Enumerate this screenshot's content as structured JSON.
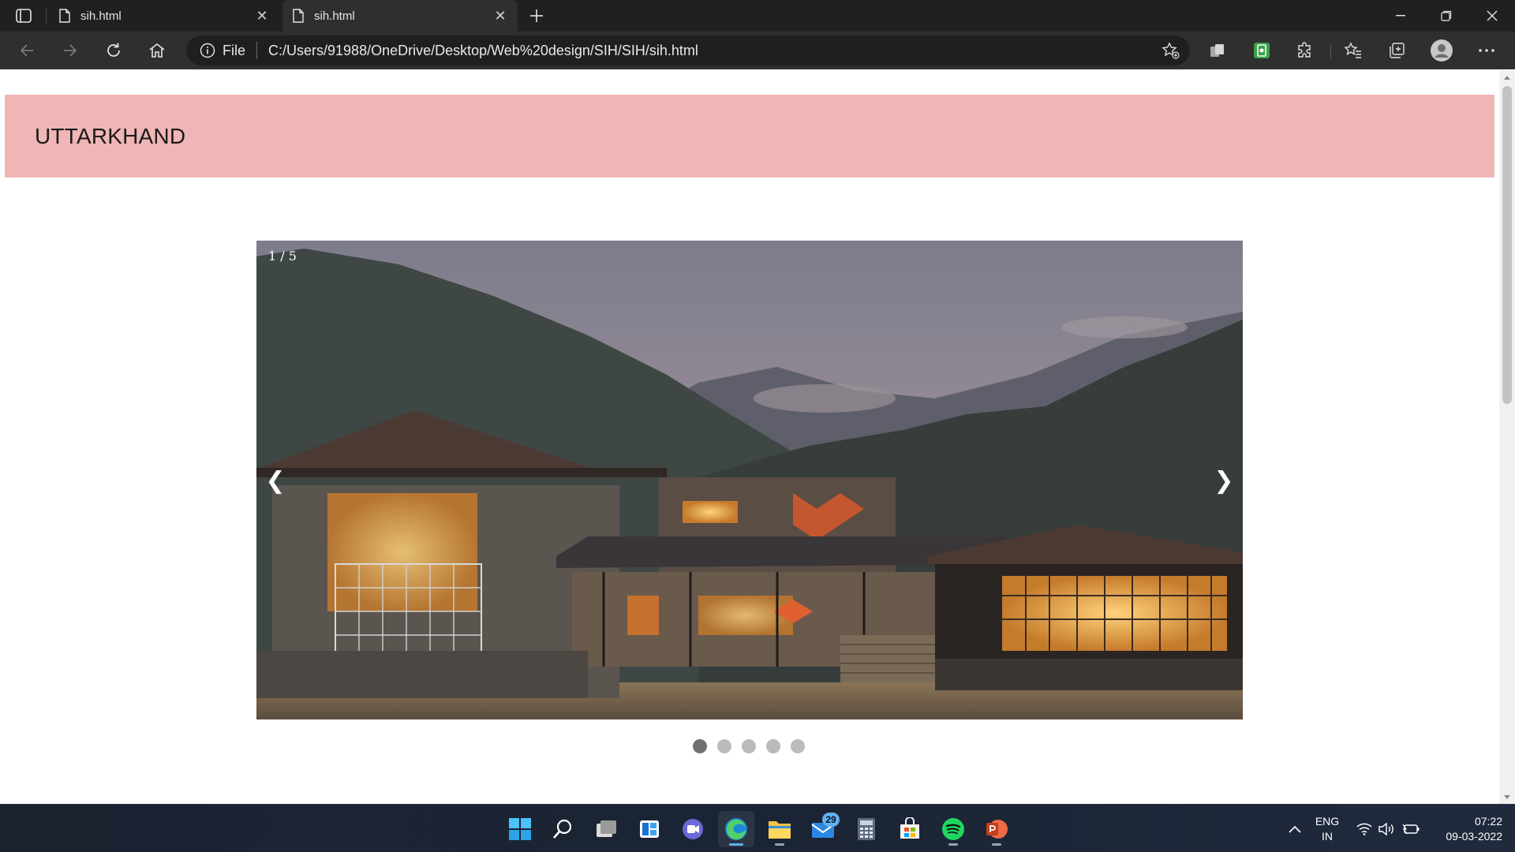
{
  "browser": {
    "tabs": [
      {
        "title": "sih.html",
        "active": false
      },
      {
        "title": "sih.html",
        "active": true
      }
    ],
    "address": {
      "scheme_label": "File",
      "url": "C:/Users/91988/OneDrive/Desktop/Web%20design/SIH/SIH/sih.html"
    }
  },
  "page": {
    "header_title": "UTTARKHAND",
    "slideshow": {
      "counter": "1 / 5",
      "prev_symbol": "❮",
      "next_symbol": "❯",
      "total_slides": 5,
      "active_index": 0
    }
  },
  "taskbar": {
    "mail_badge": "29",
    "language": {
      "line1": "ENG",
      "line2": "IN"
    },
    "clock": {
      "time": "07:22",
      "date": "09-03-2022"
    }
  },
  "colors": {
    "header_bg": "#f0b5b5",
    "dot_active": "#717171",
    "dot_inactive": "#bbbbbb",
    "chrome_dark": "#202020"
  }
}
